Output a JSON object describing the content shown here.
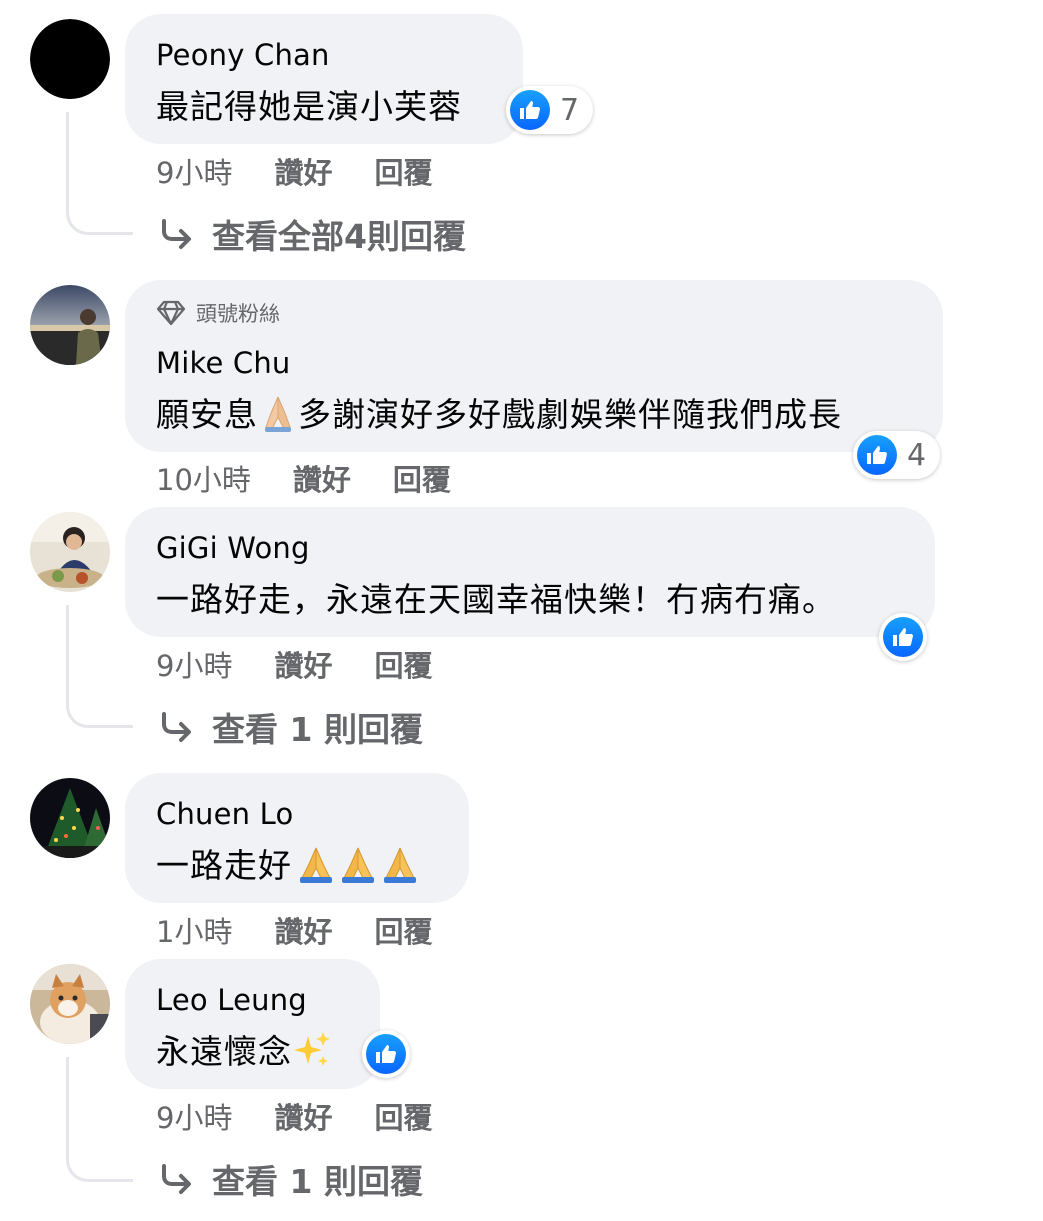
{
  "colors": {
    "bubble_bg": "#f0f2f5",
    "secondary_text": "#65676b",
    "like_blue": "#0866ff"
  },
  "comments": [
    {
      "author": "Peony Chan",
      "text": "最記得她是演小芙蓉",
      "reaction_count": "7",
      "time": "9小時",
      "like_label": "讚好",
      "reply_label": "回覆",
      "view_replies": "查看全部4則回覆"
    },
    {
      "badge": "頭號粉絲",
      "author": "Mike Chu",
      "text_before_emoji": "願安息",
      "emoji": "folded-hands",
      "text_after_emoji": "多謝演好多好戲劇娛樂伴隨我們成長",
      "reaction_count": "4",
      "time": "10小時",
      "like_label": "讚好",
      "reply_label": "回覆"
    },
    {
      "author": "GiGi Wong",
      "text": "一路好走，永遠在天國幸福快樂！冇病冇痛。",
      "time": "9小時",
      "like_label": "讚好",
      "reply_label": "回覆",
      "view_replies": "查看 1 則回覆"
    },
    {
      "author": "Chuen Lo",
      "text": "一路走好",
      "emoji": "folded-hands x3",
      "time": "1小時",
      "like_label": "讚好",
      "reply_label": "回覆"
    },
    {
      "author": "Leo Leung",
      "text": "永遠懷念",
      "emoji": "sparkles",
      "time": "9小時",
      "like_label": "讚好",
      "reply_label": "回覆",
      "view_replies": "查看 1 則回覆"
    }
  ]
}
